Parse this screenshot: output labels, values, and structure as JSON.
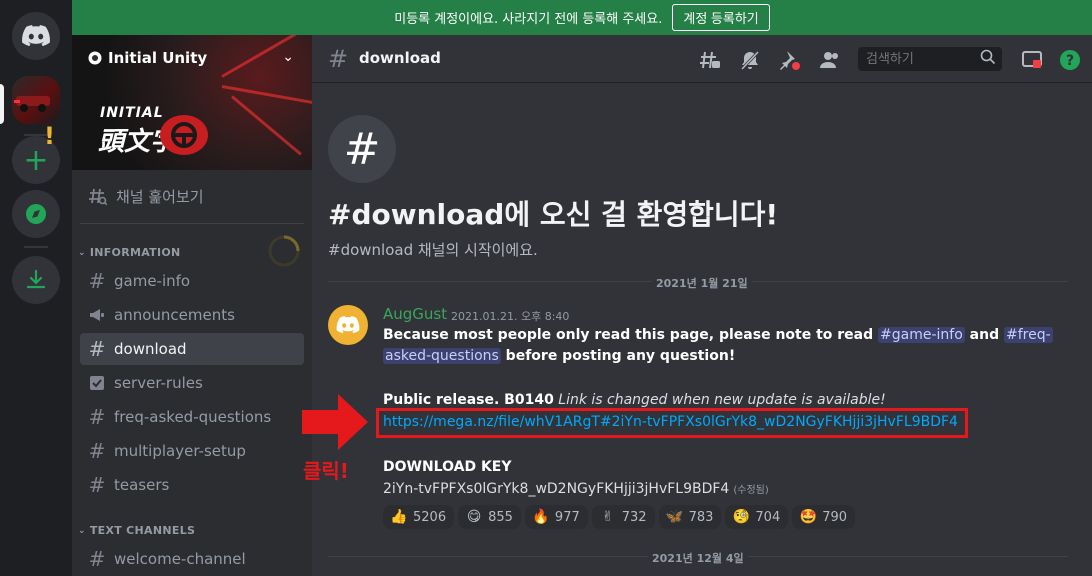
{
  "banner": {
    "message": "미등록 계정이에요. 사라지기 전에 등록해 주세요.",
    "button": "계정 등록하기"
  },
  "guild": {
    "name": "Initial Unity",
    "logo_text": "INITIAL",
    "logo_kanji": "頭文字"
  },
  "sidebar": {
    "browse_label": "채널 훑어보기",
    "categories": [
      {
        "label": "INFORMATION"
      },
      {
        "label": "TEXT CHANNELS"
      }
    ],
    "channels": [
      {
        "label": "game-info"
      },
      {
        "label": "announcements"
      },
      {
        "label": "download"
      },
      {
        "label": "server-rules"
      },
      {
        "label": "freq-asked-questions"
      },
      {
        "label": "multiplayer-setup"
      },
      {
        "label": "teasers"
      },
      {
        "label": "welcome-channel"
      }
    ]
  },
  "header": {
    "channel": "download",
    "search_placeholder": "검색하기"
  },
  "welcome": {
    "title": "#download에 오신 걸 환영합니다!",
    "subtitle": "#download 채널의 시작이에요."
  },
  "dates": [
    "2021년 1월 21일",
    "2021년 12월 4일"
  ],
  "message": {
    "author": "AugGust",
    "timestamp": "2021.01.21. 오후 8:40",
    "line1_a": "Because most people only read this page, please note to read ",
    "mention1": "#game-info",
    "line1_b": " and ",
    "mention2a": "#freq-",
    "mention2b": "asked-questions",
    "line2_b": " before posting any question!",
    "release_bold": "Public release. B0140",
    "release_italic": " Link is changed when new update is available!",
    "link": "https://mega.nz/file/whV1ARgT#2iYn-tvFPFXs0lGrYk8_wD2NGyFKHjji3jHvFL9BDF4",
    "key_label": "DOWNLOAD KEY",
    "key_value": "2iYn-tvFPFXs0lGrYk8_wD2NGyFKHjji3jHvFL9BDF4",
    "edited": "(수정됨)"
  },
  "reactions": [
    {
      "emoji": "👍",
      "count": "5206"
    },
    {
      "emoji": "😋",
      "count": "855"
    },
    {
      "emoji": "🔥",
      "count": "977"
    },
    {
      "emoji": "✌",
      "count": "732"
    },
    {
      "emoji": "🦋",
      "count": "783"
    },
    {
      "emoji": "🧐",
      "count": "704"
    },
    {
      "emoji": "🤩",
      "count": "790"
    }
  ],
  "annotation": {
    "label": "클릭!"
  },
  "colors": {
    "accent_green": "#248046",
    "link_blue": "#00a8fc",
    "annotation_red": "#e5191c",
    "author_green": "#3ba55c"
  }
}
